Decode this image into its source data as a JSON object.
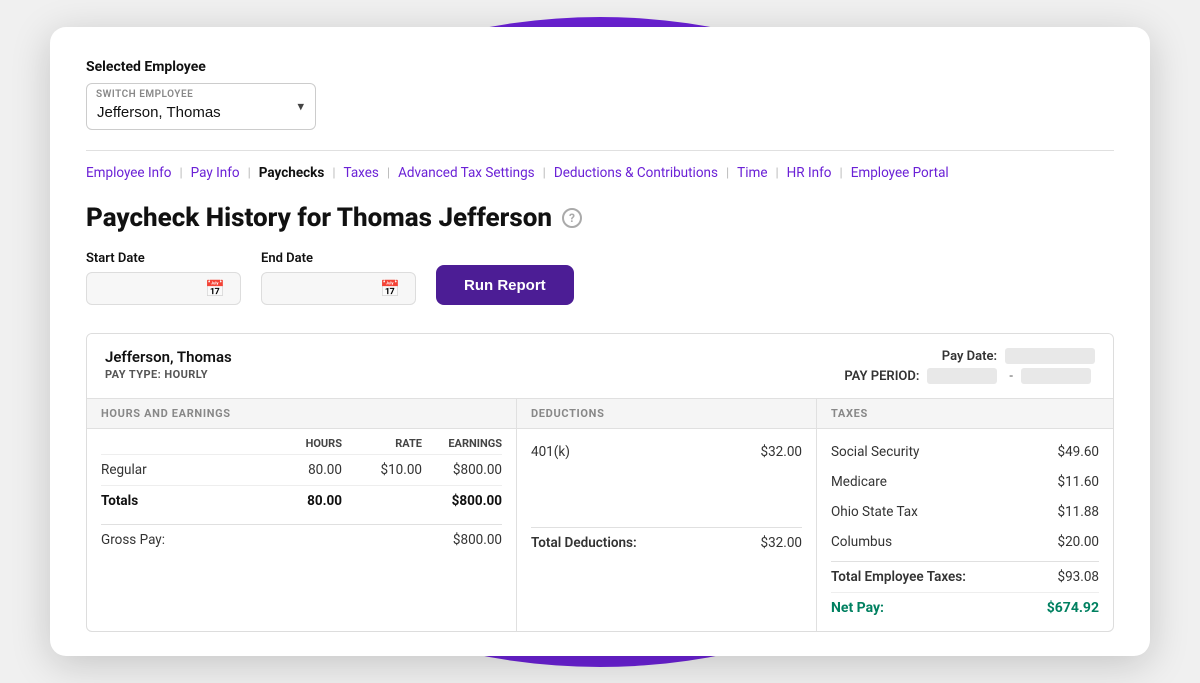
{
  "selected_employee_label": "Selected Employee",
  "switch_employee_sublabel": "SWITCH EMPLOYEE",
  "employee_name": "Jefferson, Thomas",
  "nav": {
    "items": [
      {
        "id": "employee-info",
        "label": "Employee Info",
        "active": false
      },
      {
        "id": "pay-info",
        "label": "Pay Info",
        "active": false
      },
      {
        "id": "paychecks",
        "label": "Paychecks",
        "active": true
      },
      {
        "id": "taxes",
        "label": "Taxes",
        "active": false
      },
      {
        "id": "advanced-tax-settings",
        "label": "Advanced Tax Settings",
        "active": false
      },
      {
        "id": "deductions-contributions",
        "label": "Deductions & Contributions",
        "active": false
      },
      {
        "id": "time",
        "label": "Time",
        "active": false
      },
      {
        "id": "hr-info",
        "label": "HR Info",
        "active": false
      },
      {
        "id": "employee-portal",
        "label": "Employee Portal",
        "active": false
      }
    ]
  },
  "page_title": "Paycheck History for Thomas Jefferson",
  "start_date_label": "Start Date",
  "end_date_label": "End Date",
  "run_report_label": "Run Report",
  "paycheck": {
    "employee_name": "Jefferson, Thomas",
    "pay_type_label": "PAY TYPE: HOURLY",
    "pay_date_label": "Pay Date:",
    "pay_period_label": "PAY PERIOD:",
    "columns": {
      "hours_earnings": {
        "header": "HOURS AND EARNINGS",
        "sub_headers": [
          "",
          "HOURS",
          "RATE",
          "EARNINGS"
        ],
        "rows": [
          {
            "label": "Regular",
            "hours": "80.00",
            "rate": "$10.00",
            "earnings": "$800.00"
          }
        ],
        "totals": {
          "label": "Totals",
          "hours": "80.00",
          "rate": "",
          "earnings": "$800.00"
        },
        "gross_pay": {
          "label": "Gross Pay:",
          "hours": "",
          "rate": "",
          "earnings": "$800.00"
        }
      },
      "deductions": {
        "header": "DEDUCTIONS",
        "rows": [
          {
            "label": "401(k)",
            "amount": "$32.00"
          }
        ],
        "total_label": "Total Deductions:",
        "total_amount": "$32.00"
      },
      "taxes": {
        "header": "TAXES",
        "rows": [
          {
            "label": "Social Security",
            "amount": "$49.60"
          },
          {
            "label": "Medicare",
            "amount": "$11.60"
          },
          {
            "label": "Ohio State Tax",
            "amount": "$11.88"
          },
          {
            "label": "Columbus",
            "amount": "$20.00"
          }
        ],
        "total_label": "Total Employee Taxes:",
        "total_amount": "$93.08",
        "net_pay_label": "Net Pay:",
        "net_pay_amount": "$674.92"
      }
    }
  },
  "colors": {
    "purple_dark": "#4c1d95",
    "purple_nav": "#6b21d6",
    "green": "#008060"
  }
}
